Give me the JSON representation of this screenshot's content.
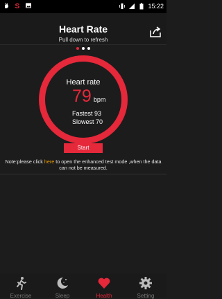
{
  "status_bar": {
    "time": "15:22"
  },
  "header": {
    "title": "Heart Rate",
    "subtitle": "Pull down to refresh"
  },
  "pager": {
    "count": 3,
    "active_index": 0
  },
  "heart": {
    "label": "Heart rate",
    "value": "79",
    "unit": "bpm",
    "fastest_label": "Fastest",
    "fastest_value": "93",
    "slowest_label": "Slowest",
    "slowest_value": "70",
    "start_label": "Start"
  },
  "note": {
    "prefix": "Note:please click ",
    "link": "here",
    "suffix": " to open the enhanced test mode ,when the data can not be measured."
  },
  "nav": [
    {
      "label": "Exercise",
      "icon": "running-person-icon",
      "active": false
    },
    {
      "label": "Sleep",
      "icon": "moon-stars-icon",
      "active": false
    },
    {
      "label": "Health",
      "icon": "heart-icon",
      "active": true
    },
    {
      "label": "Setting",
      "icon": "gear-icon",
      "active": false
    }
  ],
  "colors": {
    "accent": "#e5283a",
    "link": "#f0a000",
    "background": "#1c1c1c"
  }
}
